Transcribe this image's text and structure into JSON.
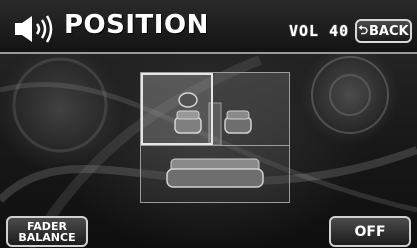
{
  "header": {
    "title": "POSITION",
    "volume_label": "VOL 40",
    "back_label": "BACK",
    "speaker_icon": "speaker-icon"
  },
  "seat_map": {
    "selected_zone": "front-left",
    "zones": [
      "front-left",
      "front-right",
      "rear"
    ]
  },
  "buttons": {
    "fader_balance_line1": "FADER",
    "fader_balance_line2": "BALANCE",
    "off_label": "OFF"
  },
  "colors": {
    "text": "#ffffff",
    "button_border": "#d0d0d0",
    "selection": "#e6e6e6"
  }
}
